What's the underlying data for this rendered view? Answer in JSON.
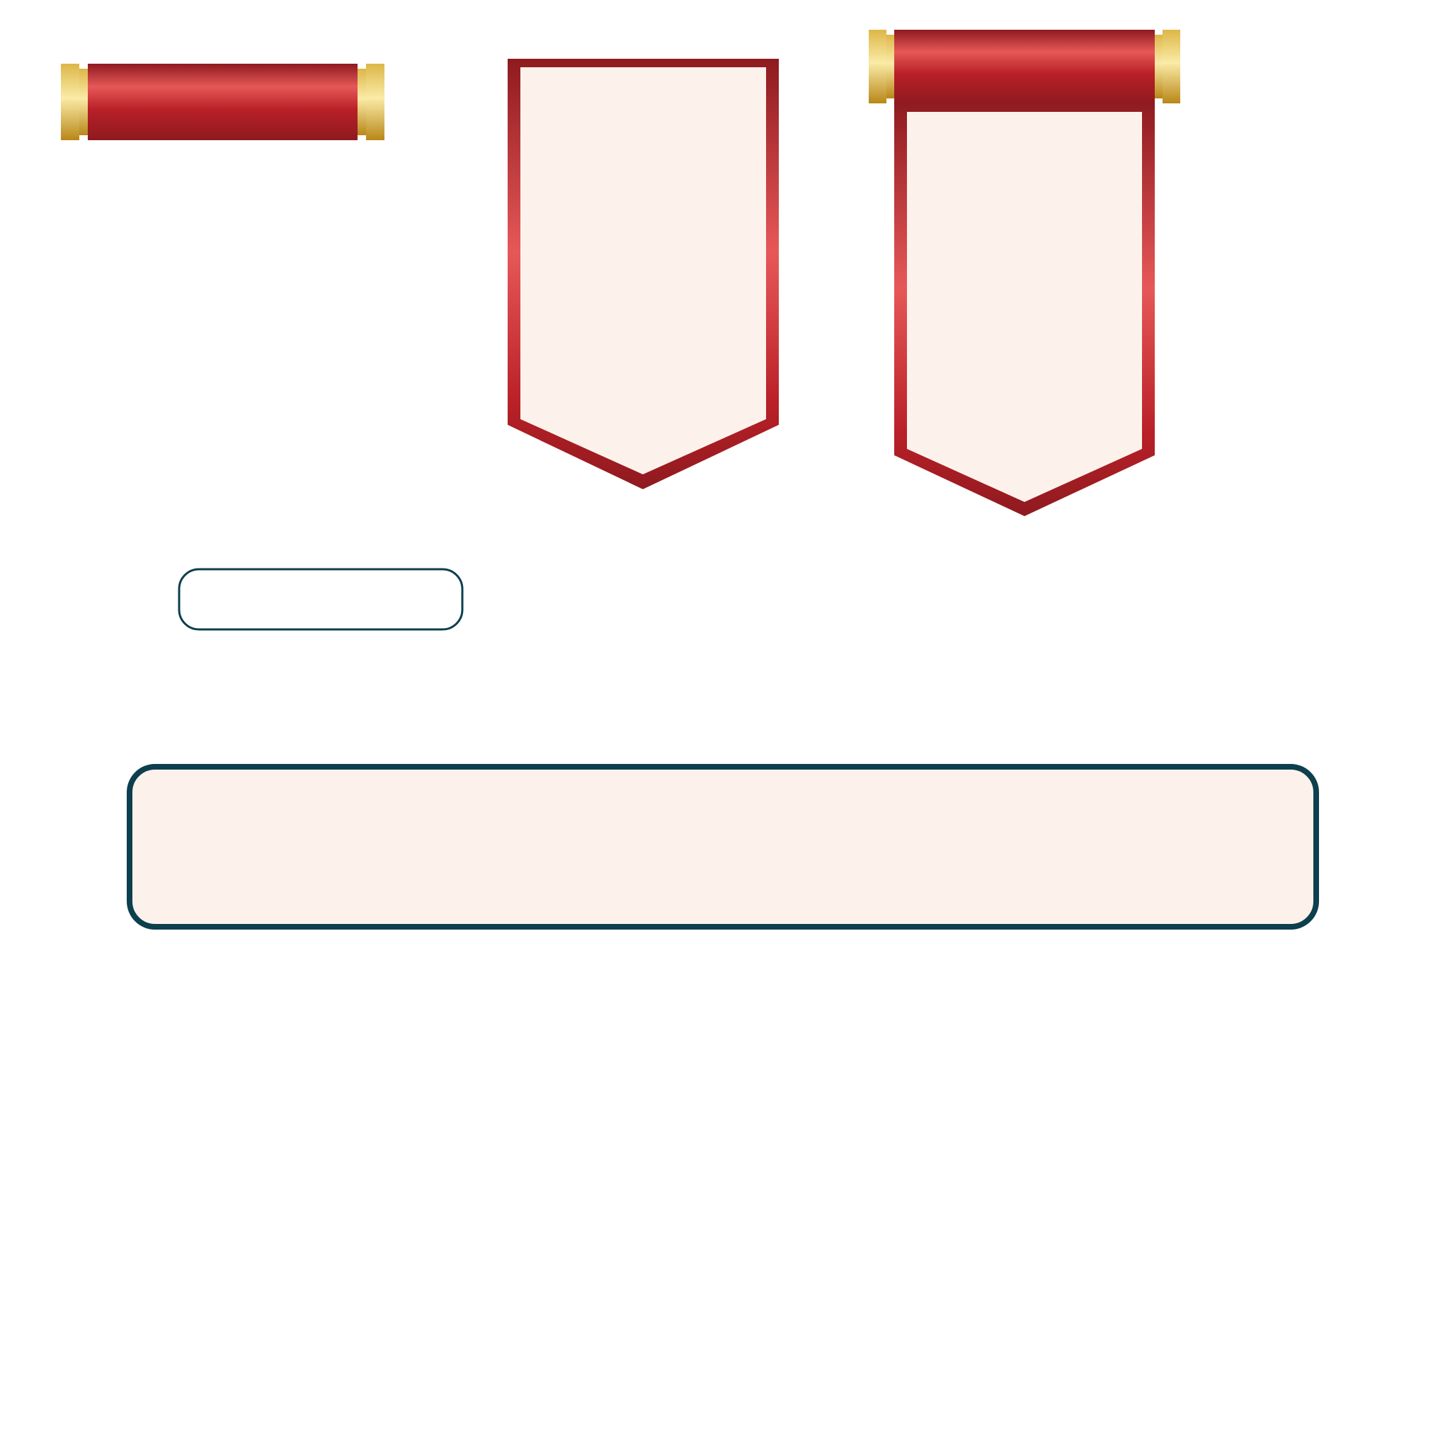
{
  "colors": {
    "background": "#ffffff",
    "ribbon_red_dark": "#8e1a1f",
    "ribbon_red_mid": "#b92027",
    "ribbon_red_light": "#e65858",
    "parchment": "#fdf2eb",
    "gold_dark": "#b98718",
    "gold_mid": "#ddb648",
    "gold_light": "#faeba6",
    "frame_teal": "#0d3f4e"
  },
  "elements": [
    {
      "kind": "scroll-roll",
      "label": ""
    },
    {
      "kind": "banner-pennant",
      "label": ""
    },
    {
      "kind": "banner-pennant-with-roll",
      "label": ""
    },
    {
      "kind": "small-outline-box",
      "label": ""
    },
    {
      "kind": "wide-parchment-box",
      "label": ""
    }
  ]
}
